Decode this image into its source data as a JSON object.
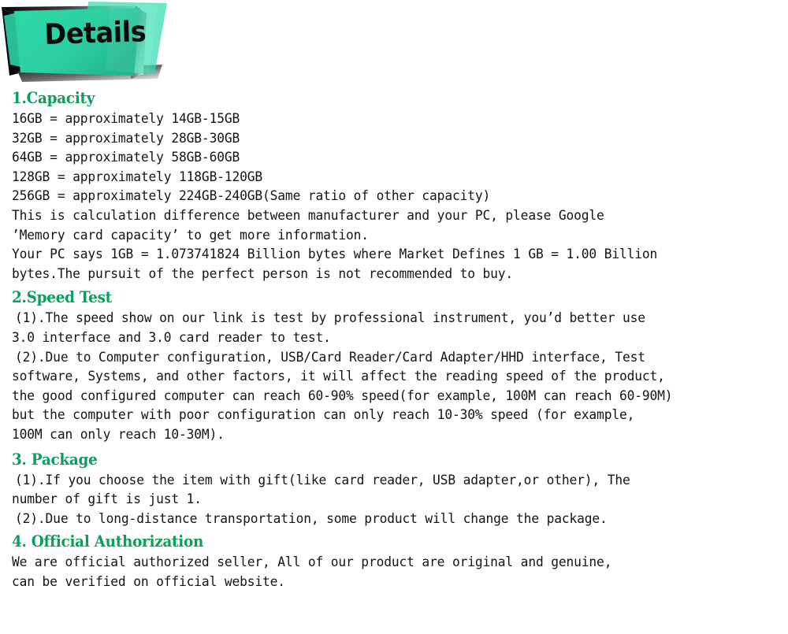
{
  "banner": {
    "title": "Details",
    "teal_color": "#2ed2a5",
    "shadow_color": "#1a1a1a"
  },
  "theme": {
    "heading_color": "#0aa05c",
    "body_color": "#141414",
    "background": "#ffffff"
  },
  "sections": [
    {
      "heading": "1.Capacity",
      "lines": "16GB = approximately 14GB-15GB\n32GB = approximately 28GB-30GB\n64GB = approximately 58GB-60GB\n128GB = approximately 118GB-120GB\n256GB = approximately 224GB-240GB(Same ratio of other capacity)\nThis is calculation difference between manufacturer and your PC, please Google\n’Memory card capacity’ to get more information.\nYour PC says 1GB = 1.073741824 Billion bytes where Market Defines 1 GB = 1.00 Billion\nbytes.The pursuit of the perfect person is not recommended to buy."
    },
    {
      "heading": "2.Speed Test",
      "para1": "(1).The speed show on our link is test by professional instrument, you’d better use",
      "para1_cont": "3.0 interface and 3.0 card reader to test.",
      "para2": "(2).Due to Computer configuration, USB/Card Reader/Card Adapter/HHD interface, Test",
      "para2_cont": "software, Systems, and other factors, it will affect the reading speed of the product,\nthe good configured computer can reach 60-90% speed(for example, 100M can reach 60-90M)\nbut the computer with poor configuration can only reach 10-30% speed (for example,\n100M can only reach 10-30M)."
    },
    {
      "heading": "3. Package",
      "para1": "(1).If you choose the item with gift(like card reader, USB adapter,or other), The",
      "para1_cont": "number of gift is just 1.",
      "para2": "(2).Due to long-distance transportation, some product will change the package."
    },
    {
      "heading": "4. Official Authorization",
      "lines": "We are official authorized seller, All of our product are original and genuine,\ncan be verified on official website."
    }
  ]
}
